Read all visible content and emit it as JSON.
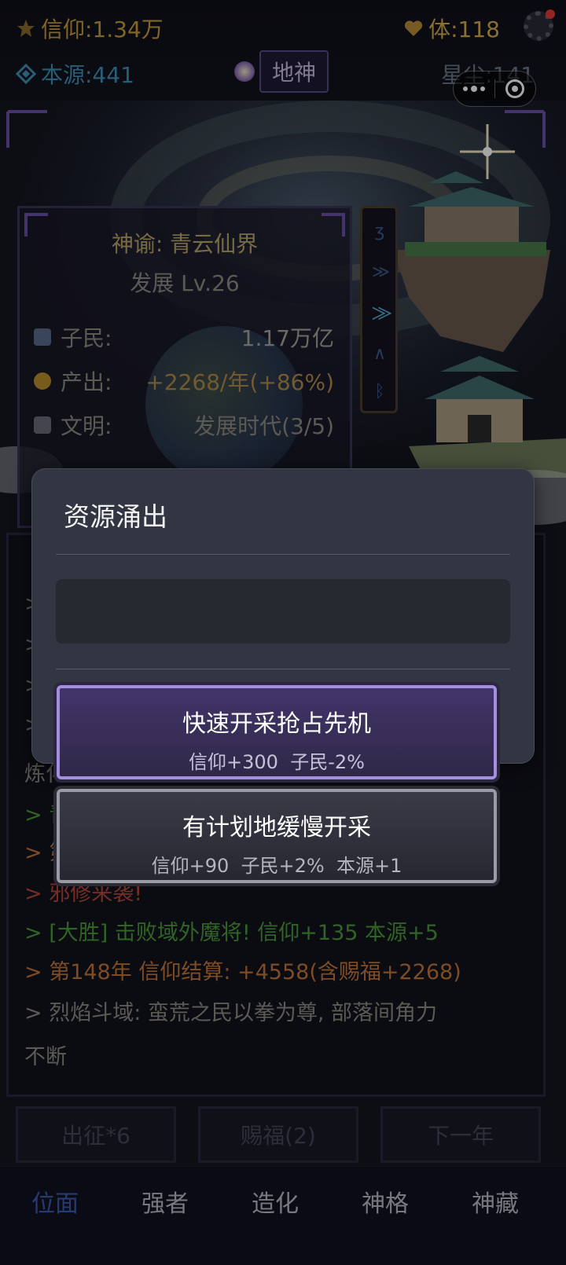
{
  "topbar": {
    "faith": "信仰:1.34万",
    "vitality": "体:118",
    "origin": "本源:441",
    "rank": "地神",
    "starcrumb": "星尘:141"
  },
  "world_panel": {
    "title": "神谕: 青云仙界",
    "level": "发展 Lv.26",
    "rows": [
      {
        "label": "子民:",
        "value": "1.17万亿"
      },
      {
        "label": "产出:",
        "value": "+2268/年(+86%)"
      },
      {
        "label": "文明:",
        "value": "发展时代(3/5)"
      }
    ]
  },
  "log": {
    "lines": [
      {
        "text": ">",
        "color": "gy"
      },
      {
        "text": ">",
        "color": "gy"
      },
      {
        "text": ">",
        "color": "gy"
      },
      {
        "text": ">",
        "color": "gy"
      },
      {
        "text": "炼化",
        "color": "gy"
      },
      {
        "text": "> 青",
        "color": "gr"
      },
      {
        "text": "> 第",
        "color": "or"
      },
      {
        "text": "> 邪修来袭!",
        "color": "rd"
      },
      {
        "text": "> [大胜] 击败域外魔将! 信仰+135 本源+5",
        "color": "gr"
      },
      {
        "text": "> 第148年 信仰结算: +4558(含赐福+2268)",
        "color": "or"
      },
      {
        "text": "> 烈焰斗域: 蛮荒之民以拳为尊, 部落间角力",
        "color": "gy"
      },
      {
        "text": "不断",
        "color": "gy"
      }
    ]
  },
  "actions": {
    "expedition": "出征*6",
    "bless": "赐福(2)",
    "next_year": "下一年"
  },
  "tabs": [
    "位面",
    "强者",
    "造化",
    "神格",
    "神藏"
  ],
  "modal": {
    "title": "资源涌出",
    "message": "",
    "choices": [
      {
        "label": "快速开采抢占先机",
        "effects": "信仰+300  子民-2%"
      },
      {
        "label": "有计划地缓慢开采",
        "effects": "信仰+90  子民+2%  本源+1"
      }
    ]
  },
  "colors": {
    "accent_purple": "#a58ede",
    "faith_gold": "#c79a3c",
    "origin_blue": "#3f8fb6",
    "log_green": "#4a9a3a",
    "log_orange": "#c0763a",
    "log_red": "#b2483a",
    "tab_active": "#3a5bb0"
  }
}
